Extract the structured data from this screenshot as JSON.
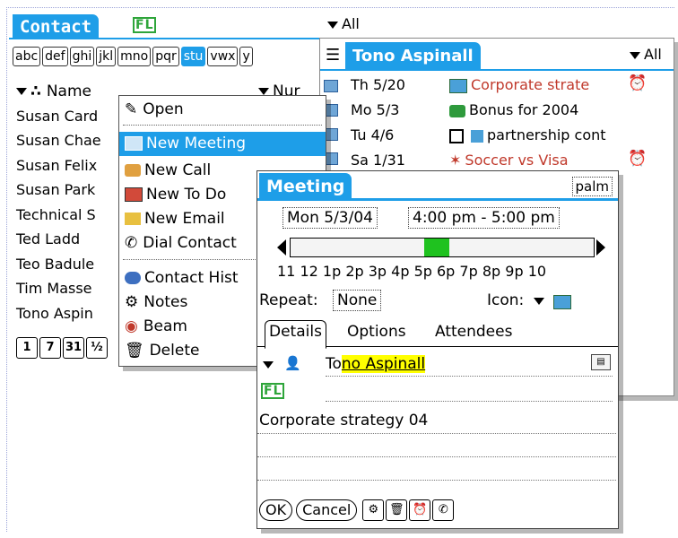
{
  "contact": {
    "title": "Contact",
    "category": "All",
    "alpha_tabs": [
      "abc",
      "def",
      "ghi",
      "jkl",
      "mno",
      "pqr",
      "stu",
      "vwx",
      "y"
    ],
    "selected_alpha": "stu",
    "columns": {
      "name": "Name",
      "number": "Nur"
    },
    "rows": [
      "Susan Card",
      "Susan Chae",
      "Susan Felix",
      "Susan Park",
      "Technical S",
      "Ted Ladd",
      "Teo Badule",
      "Tim Masse",
      "Tono Aspin"
    ],
    "bottom_buttons": [
      "1",
      "7",
      "31",
      "½"
    ]
  },
  "context_menu": {
    "items": [
      {
        "label": "Open",
        "icon": "open-icon"
      },
      {
        "label": "New Meeting",
        "icon": "meeting-icon",
        "selected": true
      },
      {
        "label": "New Call",
        "icon": "phone-icon"
      },
      {
        "label": "New To Do",
        "icon": "todo-icon"
      },
      {
        "label": "New Email",
        "icon": "email-icon"
      },
      {
        "label": "Dial Contact",
        "icon": "dial-icon"
      },
      {
        "label": "Contact Hist",
        "icon": "history-icon"
      },
      {
        "label": "Notes",
        "icon": "notes-icon"
      },
      {
        "label": "Beam",
        "icon": "beam-icon"
      },
      {
        "label": "Delete",
        "icon": "trash-icon"
      }
    ]
  },
  "tono": {
    "title": "Tono Aspinall",
    "category": "All",
    "entries": [
      {
        "date": "Th  5/20",
        "text": "Corporate strate",
        "color": "#c0392b",
        "alarm": true
      },
      {
        "date": "Mo  5/3",
        "text": "Bonus for 2004",
        "color": "#000000",
        "alarm": false
      },
      {
        "date": "Tu  4/6",
        "text": "partnership cont",
        "color": "#000000",
        "alarm": false
      },
      {
        "date": "Sa  1/31",
        "text": "Soccer vs Visa",
        "color": "#c0392b",
        "alarm": true
      }
    ]
  },
  "meeting": {
    "title": "Meeting",
    "tag": "palm",
    "date": "Mon 5/3/04",
    "time": "4:00 pm - 5:00 pm",
    "hours": "11 12 1p 2p 3p 4p 5p 6p 7p 8p 9p 10",
    "repeat_label": "Repeat:",
    "repeat_value": "None",
    "icon_label": "Icon:",
    "tabs": [
      "Details",
      "Options",
      "Attendees"
    ],
    "attendee_prefix": "To",
    "attendee_highlight": "no Aspinall",
    "notes": "Corporate strategy 04",
    "buttons": {
      "ok": "OK",
      "cancel": "Cancel"
    }
  },
  "colors": {
    "accent": "#1e9ee8",
    "highlight": "#ffff00",
    "timebar": "#1fc21f"
  }
}
